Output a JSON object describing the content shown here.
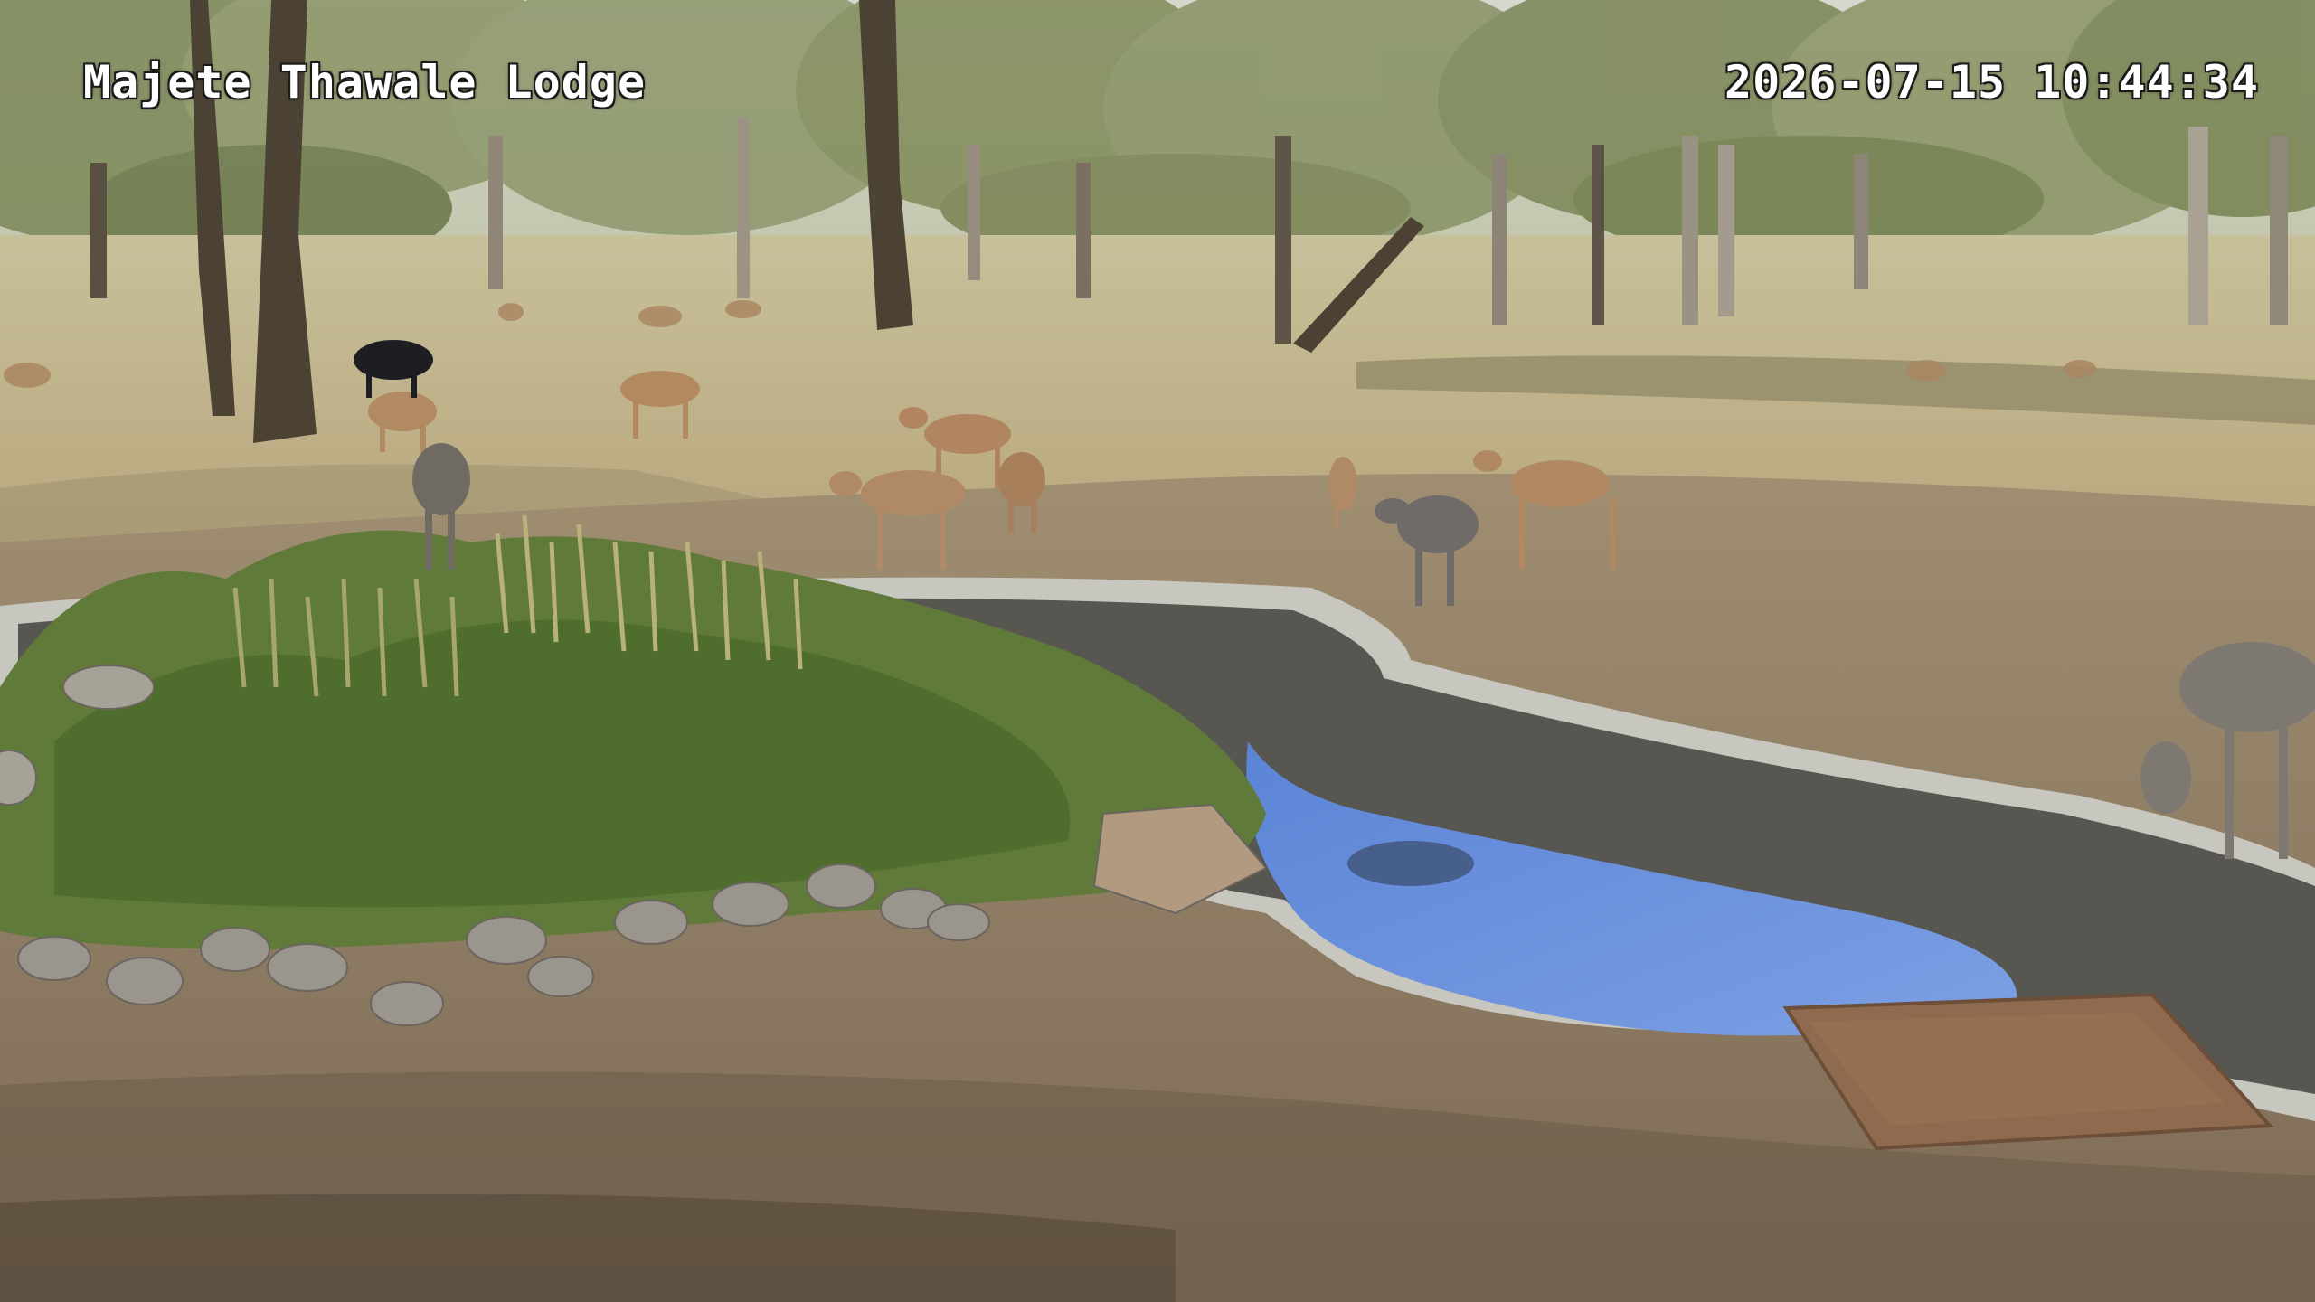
{
  "camera": {
    "location_label": "Majete Thawale Lodge",
    "timestamp": "2026-07-15 10:44:34"
  }
}
